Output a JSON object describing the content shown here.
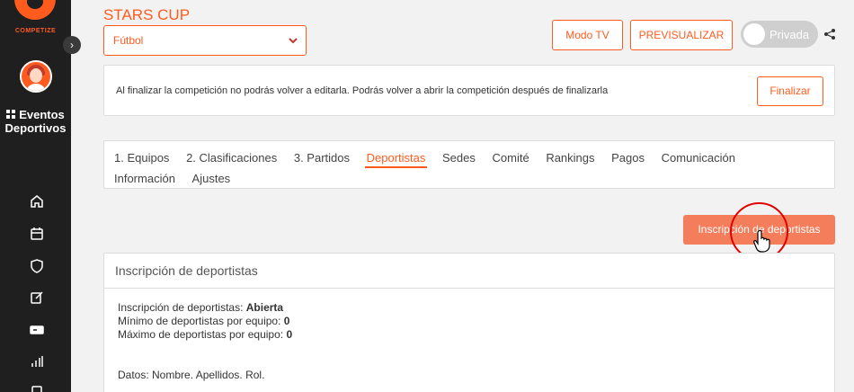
{
  "sidebar": {
    "logo_text": "COMPETIZE",
    "section_title": "Eventos Deportivos",
    "nav_icons": [
      "home-icon",
      "calendar-icon",
      "shield-icon",
      "edit-icon",
      "ticket-icon",
      "stats-icon",
      "document-icon"
    ]
  },
  "header": {
    "title": "STARS CUP",
    "sport_selected": "Fútbol",
    "btn_tv": "Modo TV",
    "btn_preview": "PREVISUALIZAR",
    "privacy_toggle": "Privada"
  },
  "notice": {
    "text": "Al finalizar la competición no podrás volver a editarla. Podrás volver a abrir la competición después de finalizarla",
    "button": "Finalizar"
  },
  "tabs": [
    {
      "label": "1. Equipos",
      "active": false
    },
    {
      "label": "2. Clasificaciones",
      "active": false
    },
    {
      "label": "3. Partidos",
      "active": false
    },
    {
      "label": "Deportistas",
      "active": true
    },
    {
      "label": "Sedes",
      "active": false
    },
    {
      "label": "Comité",
      "active": false
    },
    {
      "label": "Rankings",
      "active": false
    },
    {
      "label": "Pagos",
      "active": false
    },
    {
      "label": "Comunicación",
      "active": false
    },
    {
      "label": "Información",
      "active": false
    },
    {
      "label": "Ajustes",
      "active": false
    }
  ],
  "action_button": "Inscripción de deportistas",
  "details": {
    "header": "Inscripción de deportistas",
    "status_label": "Inscripción de deportistas:",
    "status_value": "Abierta",
    "min_label": "Mínimo de deportistas por equipo:",
    "min_value": "0",
    "max_label": "Máximo de deportistas por equipo:",
    "max_value": "0",
    "fields": "Datos: Nombre. Apellidos. Rol."
  },
  "colors": {
    "accent": "#ff5b1f",
    "sidebar_bg": "#1f1f1f",
    "action_bg": "#f47e5c",
    "annotation": "#e00000"
  }
}
